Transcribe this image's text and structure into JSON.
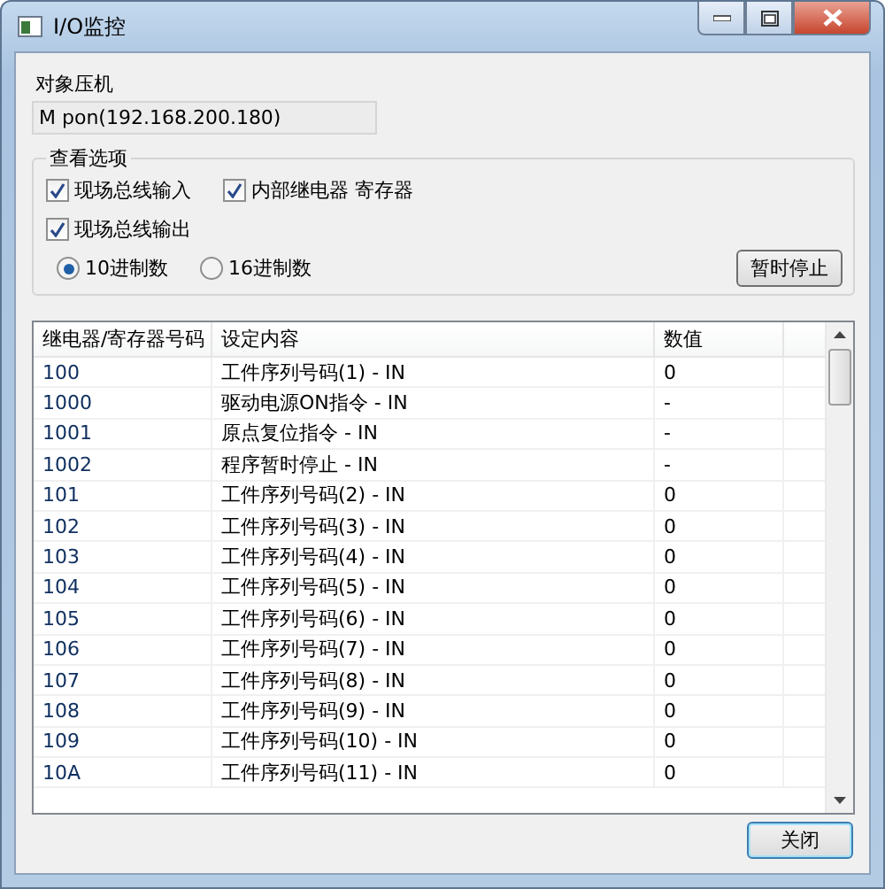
{
  "window": {
    "title": "I/O监控"
  },
  "target": {
    "label": "对象压机",
    "value": "M pon(192.168.200.180)"
  },
  "options": {
    "title": "查看选项",
    "checkboxes": [
      {
        "label": "现场总线输入",
        "checked": true
      },
      {
        "label": "内部继电器 寄存器",
        "checked": true
      },
      {
        "label": "现场总线输出",
        "checked": true
      }
    ],
    "radios": [
      {
        "label": "10进制数",
        "selected": true
      },
      {
        "label": "16进制数",
        "selected": false
      }
    ],
    "pause_button": "暂时停止"
  },
  "table": {
    "columns": [
      "继电器/寄存器号码",
      "设定内容",
      "数值"
    ],
    "rows": [
      [
        "100",
        "工件序列号码(1) - IN",
        "0"
      ],
      [
        "1000",
        "驱动电源ON指令 - IN",
        "-"
      ],
      [
        "1001",
        "原点复位指令 - IN",
        "-"
      ],
      [
        "1002",
        "程序暂时停止 - IN",
        "-"
      ],
      [
        "101",
        "工件序列号码(2) - IN",
        "0"
      ],
      [
        "102",
        "工件序列号码(3) - IN",
        "0"
      ],
      [
        "103",
        "工件序列号码(4) - IN",
        "0"
      ],
      [
        "104",
        "工件序列号码(5) - IN",
        "0"
      ],
      [
        "105",
        "工件序列号码(6) - IN",
        "0"
      ],
      [
        "106",
        "工件序列号码(7) - IN",
        "0"
      ],
      [
        "107",
        "工件序列号码(8) - IN",
        "0"
      ],
      [
        "108",
        "工件序列号码(9) - IN",
        "0"
      ],
      [
        "109",
        "工件序列号码(10) - IN",
        "0"
      ],
      [
        "10A",
        "工件序列号码(11) - IN",
        "0"
      ]
    ]
  },
  "close_button": "关闭"
}
